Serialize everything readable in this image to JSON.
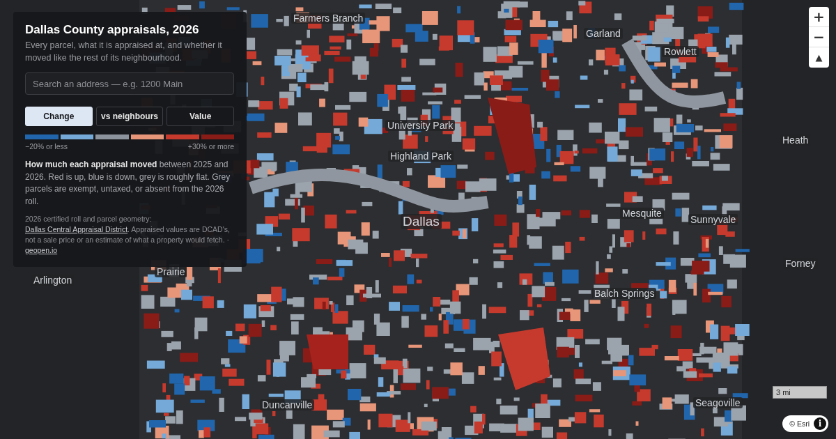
{
  "panel": {
    "title": "Dallas County appraisals, 2026",
    "subtitle": "Every parcel, what it is appraised at, and whether it moved like the rest of its neighbourhood.",
    "search": {
      "placeholder": "Search an address — e.g. 1200 Main"
    },
    "modes": [
      {
        "label": "Change",
        "selected": true
      },
      {
        "label": "vs neighbours",
        "selected": false
      },
      {
        "label": "Value",
        "selected": false
      }
    ],
    "legend": {
      "swatches": [
        {
          "color": "#2166ac"
        },
        {
          "color": "#74a9d8"
        },
        {
          "color": "#8c939c"
        },
        {
          "color": "#e8967a"
        },
        {
          "color": "#c63a2e"
        },
        {
          "color": "#8a1c18"
        }
      ],
      "low_label": "−20% or less",
      "high_label": "+30% or more"
    },
    "description": "**How much each appraisal moved** between 2025 and 2026. Red is up, blue is down, grey is roughly flat. Grey parcels are exempt, untaxed, or absent from the 2026 roll.",
    "source": {
      "before": "2026 certified roll and parcel geometry: ",
      "link": "Dallas Central Appraisal District",
      "after": ". Appraised values are DCAD's, not a sale price or an estimate of what a property would fetch. · ",
      "site_link": "geopen.io"
    }
  },
  "map": {
    "places": [
      {
        "name": "Farmers Branch"
      },
      {
        "name": "Garland"
      },
      {
        "name": "Rowlett"
      },
      {
        "name": "University Park"
      },
      {
        "name": "Highland Park"
      },
      {
        "name": "Dallas"
      },
      {
        "name": "Mesquite"
      },
      {
        "name": "Sunnyvale"
      },
      {
        "name": "Heath"
      },
      {
        "name": "Arlington"
      },
      {
        "name": "Forney"
      },
      {
        "name": "Balch Springs"
      },
      {
        "name": "Prairie"
      },
      {
        "name": "Duncanville"
      },
      {
        "name": "Seagoville"
      }
    ],
    "zoom_in": "+",
    "zoom_out": "−",
    "compass": "▲",
    "scale": "3 mi",
    "attribution": "© Esri",
    "info": "i"
  }
}
